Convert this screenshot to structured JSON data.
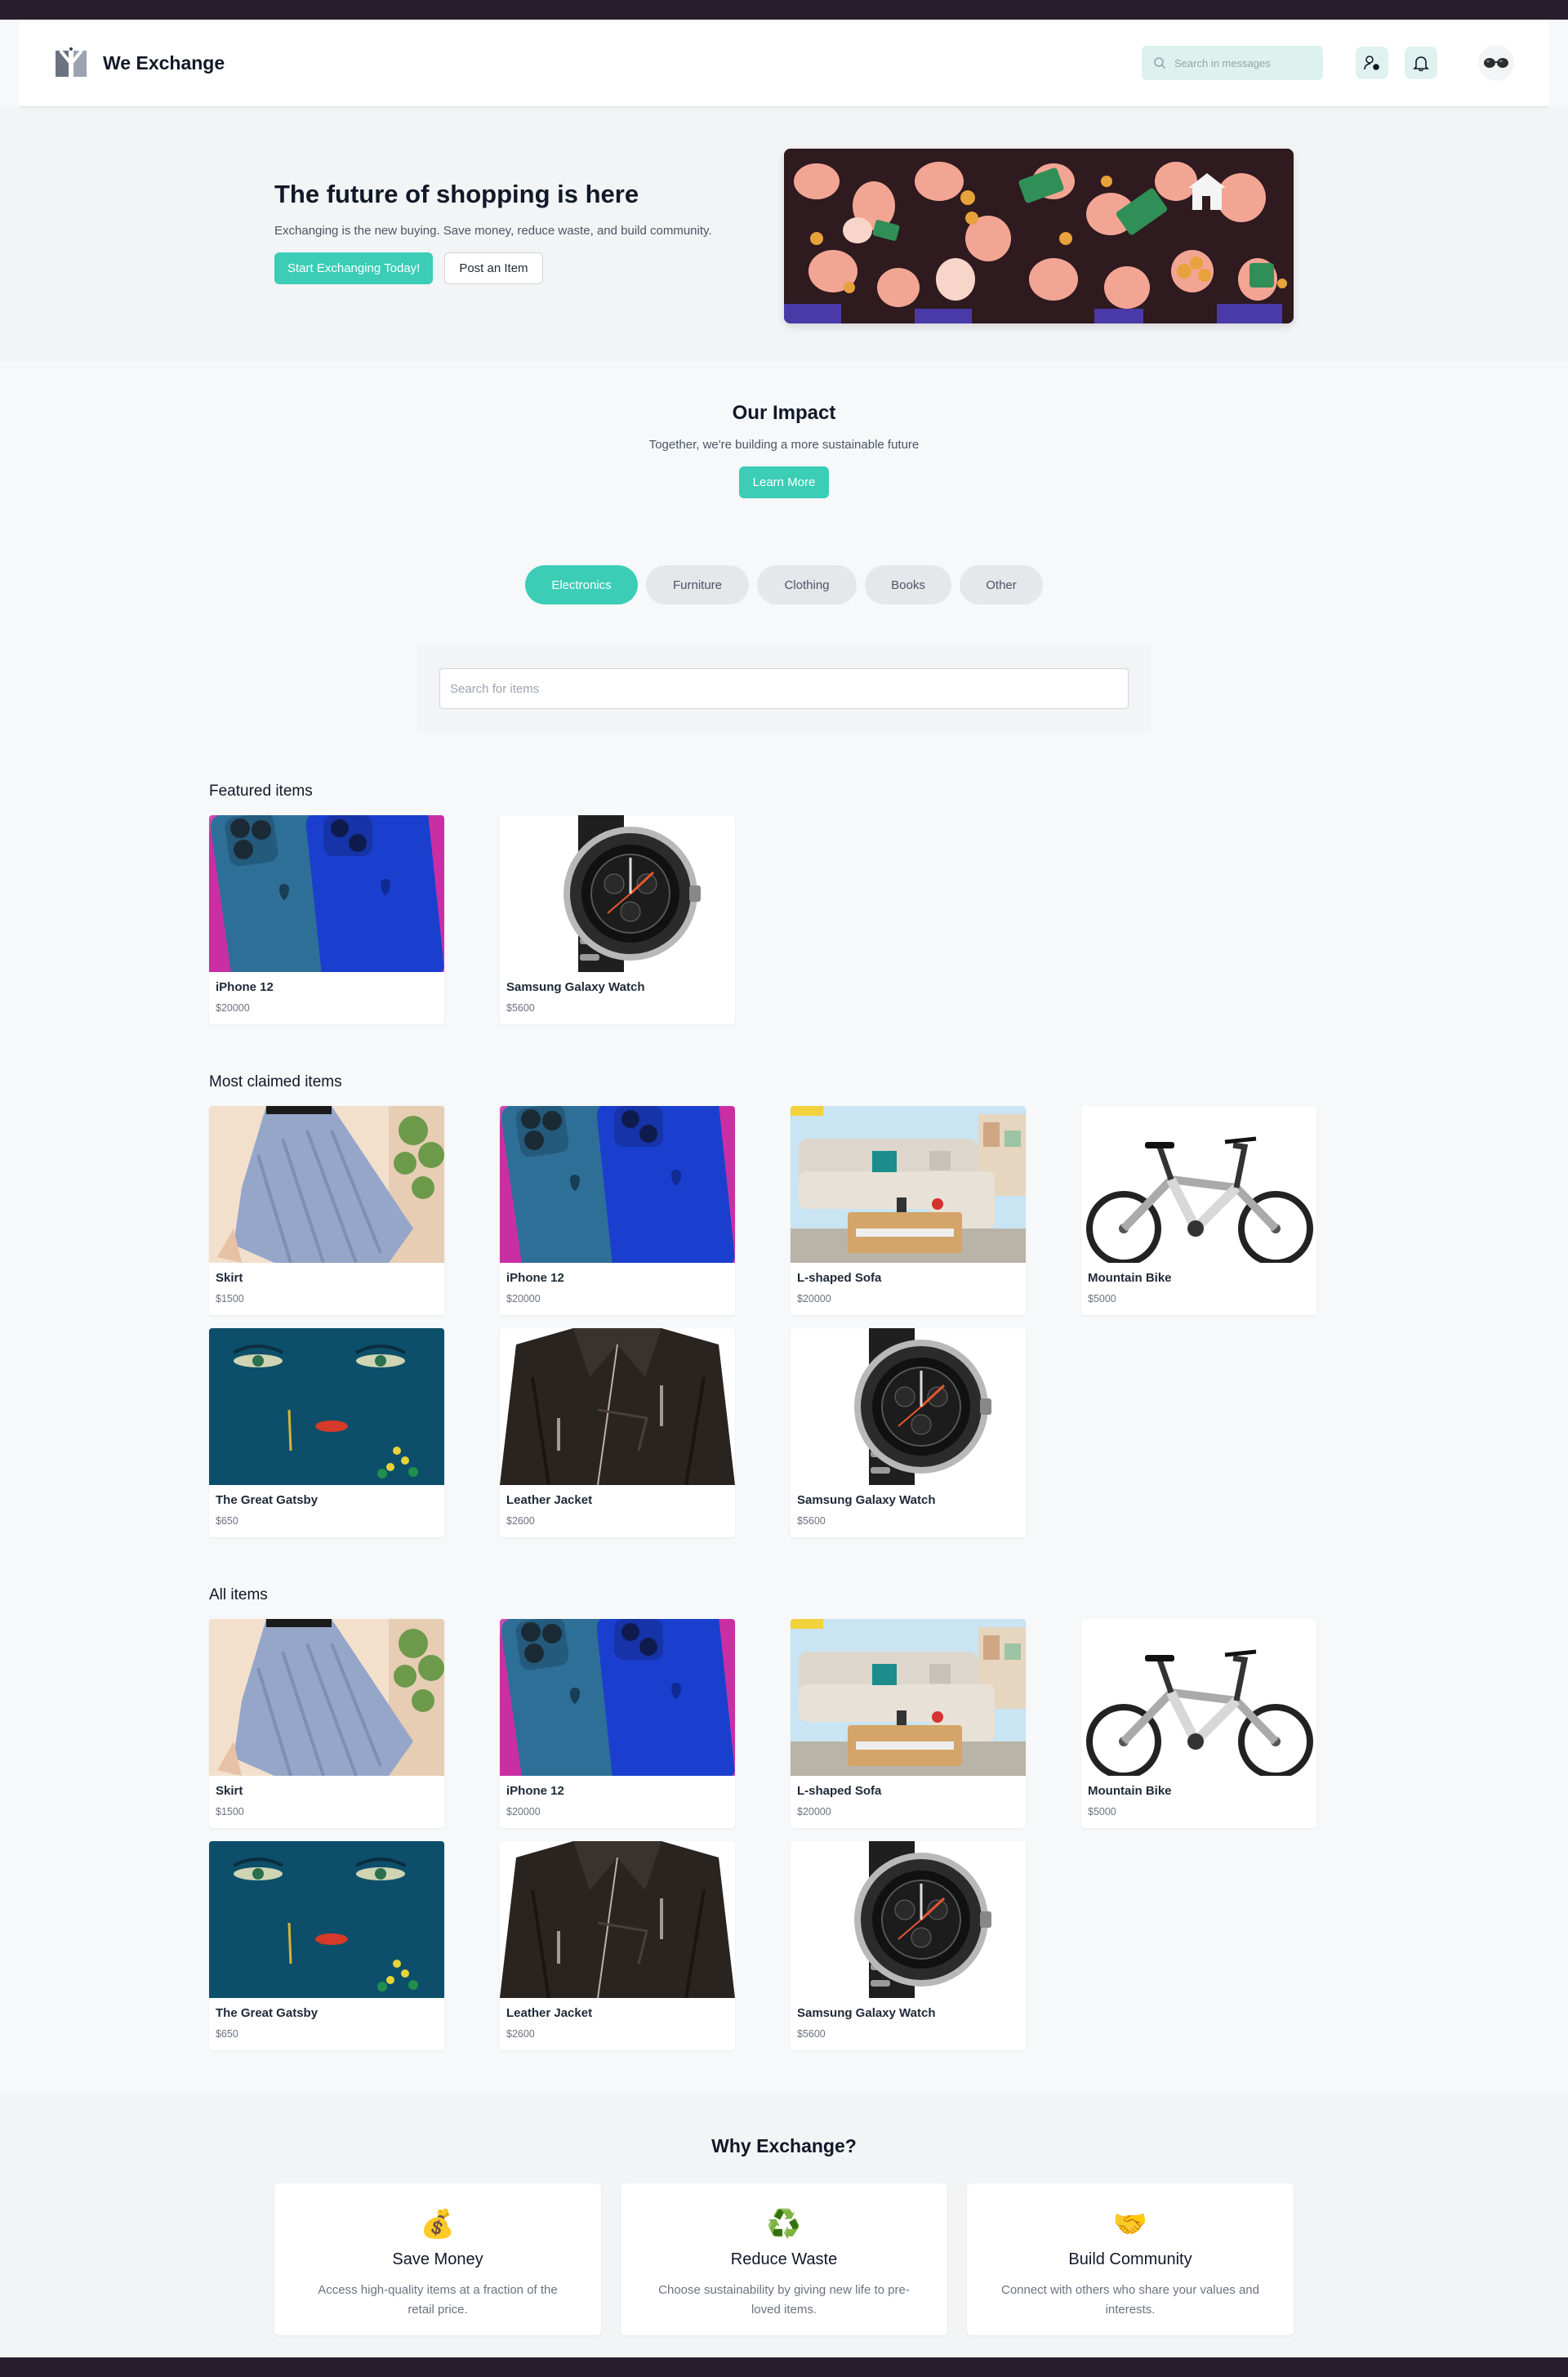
{
  "header": {
    "brand": "We Exchange",
    "message_search_placeholder": "Search in messages"
  },
  "hero": {
    "title": "The future of shopping is here",
    "subtitle": "Exchanging is the new buying. Save money, reduce waste, and build community.",
    "primary_button": "Start Exchanging Today!",
    "secondary_button": "Post an Item"
  },
  "impact": {
    "title": "Our Impact",
    "subtitle": "Together, we're building a more sustainable future",
    "button": "Learn More"
  },
  "categories": [
    {
      "label": "Electronics",
      "active": true
    },
    {
      "label": "Furniture",
      "active": false
    },
    {
      "label": "Clothing",
      "active": false
    },
    {
      "label": "Books",
      "active": false
    },
    {
      "label": "Other",
      "active": false
    }
  ],
  "item_search_placeholder": "Search for items",
  "featured": {
    "title": "Featured items",
    "items": [
      {
        "name": "iPhone 12",
        "price": "$20000",
        "image": "iphone"
      },
      {
        "name": "Samsung Galaxy Watch",
        "price": "$5600",
        "image": "watch"
      }
    ]
  },
  "most_claimed": {
    "title": "Most claimed items",
    "items": [
      {
        "name": "Skirt",
        "price": "$1500",
        "image": "skirt"
      },
      {
        "name": "iPhone 12",
        "price": "$20000",
        "image": "iphone"
      },
      {
        "name": "L-shaped Sofa",
        "price": "$20000",
        "image": "sofa"
      },
      {
        "name": "Mountain Bike",
        "price": "$5000",
        "image": "bike"
      },
      {
        "name": "The Great Gatsby",
        "price": "$650",
        "image": "gatsby"
      },
      {
        "name": "Leather Jacket",
        "price": "$2600",
        "image": "jacket"
      },
      {
        "name": "Samsung Galaxy Watch",
        "price": "$5600",
        "image": "watch"
      }
    ]
  },
  "all_items": {
    "title": "All items",
    "items": [
      {
        "name": "Skirt",
        "price": "$1500",
        "image": "skirt"
      },
      {
        "name": "iPhone 12",
        "price": "$20000",
        "image": "iphone"
      },
      {
        "name": "L-shaped Sofa",
        "price": "$20000",
        "image": "sofa"
      },
      {
        "name": "Mountain Bike",
        "price": "$5000",
        "image": "bike"
      },
      {
        "name": "The Great Gatsby",
        "price": "$650",
        "image": "gatsby"
      },
      {
        "name": "Leather Jacket",
        "price": "$2600",
        "image": "jacket"
      },
      {
        "name": "Samsung Galaxy Watch",
        "price": "$5600",
        "image": "watch"
      }
    ]
  },
  "why": {
    "title": "Why Exchange?",
    "cards": [
      {
        "icon": "money-bag-icon",
        "glyph": "💰",
        "title": "Save Money",
        "desc": "Access high-quality items at a fraction of the retail price."
      },
      {
        "icon": "recycle-icon",
        "glyph": "♻️",
        "title": "Reduce Waste",
        "desc": "Choose sustainability by giving new life to pre-loved items."
      },
      {
        "icon": "handshake-icon",
        "glyph": "🤝",
        "title": "Build Community",
        "desc": "Connect with others who share your values and interests."
      }
    ]
  },
  "colors": {
    "accent": "#3ccdb7",
    "top_bar": "#271d2b"
  }
}
